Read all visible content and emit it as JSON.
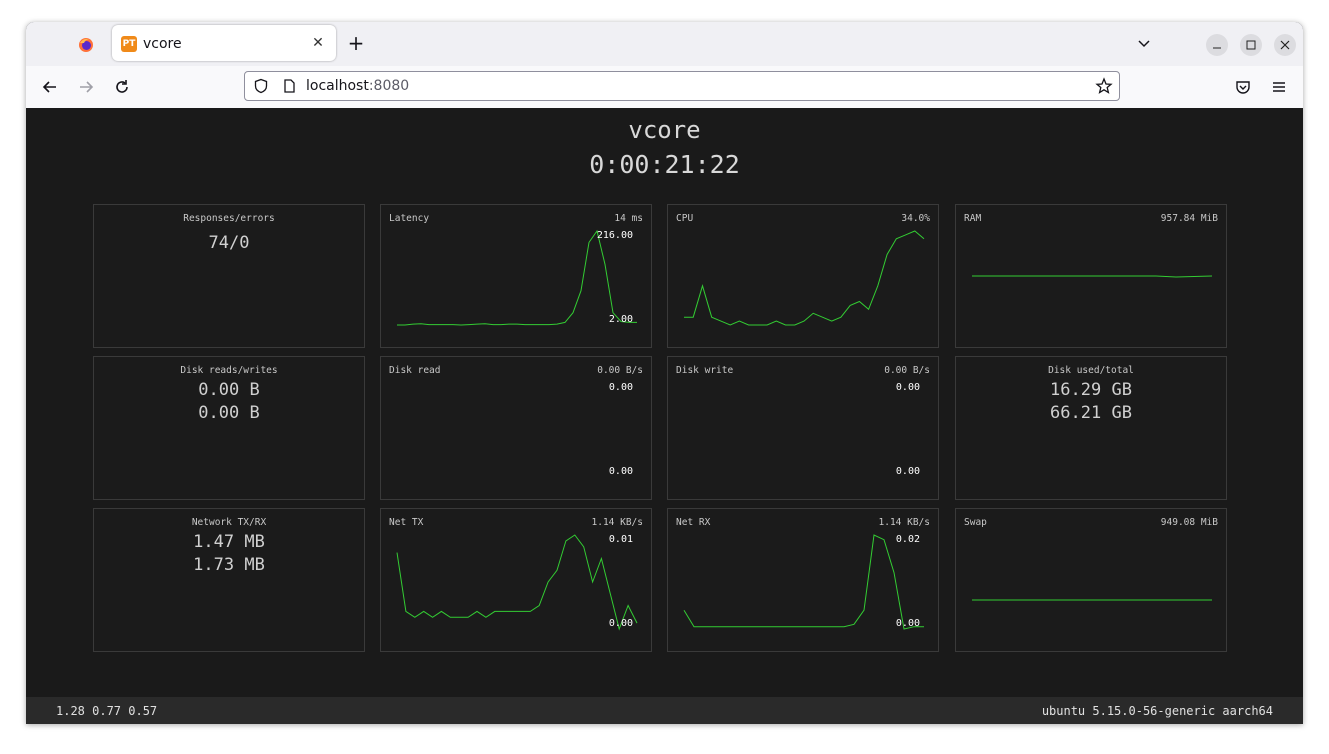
{
  "browser": {
    "tab_title": "vcore",
    "tab_favicon_text": "PT",
    "url_host": "localhost",
    "url_port": ":8080"
  },
  "app": {
    "title": "vcore",
    "uptime": "0:00:21:22"
  },
  "panels": {
    "responses": {
      "label": "Responses/errors",
      "value": "74/0"
    },
    "latency": {
      "label": "Latency",
      "current": "14 ms",
      "max": "216.00",
      "min": "2.00",
      "series": [
        2,
        2,
        4,
        5,
        3,
        3,
        3,
        3,
        2,
        3,
        4,
        5,
        3,
        3,
        4,
        4,
        3,
        3,
        3,
        3,
        4,
        8,
        30,
        80,
        190,
        216,
        140,
        30,
        10,
        8,
        8
      ]
    },
    "cpu": {
      "label": "CPU",
      "current": "34.0%",
      "series": [
        6,
        6,
        14,
        6,
        5,
        4,
        5,
        4,
        4,
        4,
        5,
        4,
        4,
        5,
        7,
        6,
        5,
        6,
        9,
        10,
        8,
        14,
        22,
        26,
        27,
        28,
        26
      ]
    },
    "ram": {
      "label": "RAM",
      "current": "957.84 MiB"
    },
    "disk_rw": {
      "label": "Disk reads/writes",
      "read": "0.00 B",
      "write": "0.00 B"
    },
    "disk_read": {
      "label": "Disk read",
      "current": "0.00 B/s",
      "max": "0.00",
      "min": "0.00"
    },
    "disk_write": {
      "label": "Disk write",
      "current": "0.00 B/s",
      "max": "0.00",
      "min": "0.00"
    },
    "disk_used": {
      "label": "Disk used/total",
      "used": "16.29 GB",
      "total": "66.21 GB"
    },
    "network": {
      "label": "Network TX/RX",
      "tx": "1.47 MB",
      "rx": "1.73 MB"
    },
    "net_tx": {
      "label": "Net TX",
      "current": "1.14 KB/s",
      "max": "0.01",
      "min": "0.00",
      "series": [
        0.007,
        0.002,
        0.0015,
        0.002,
        0.0015,
        0.002,
        0.0015,
        0.0015,
        0.0015,
        0.002,
        0.0015,
        0.002,
        0.002,
        0.002,
        0.002,
        0.002,
        0.0025,
        0.0045,
        0.0055,
        0.008,
        0.0085,
        0.0075,
        0.0045,
        0.0065,
        0.0035,
        0.0005,
        0.0025,
        0.001
      ]
    },
    "net_rx": {
      "label": "Net RX",
      "current": "1.14 KB/s",
      "max": "0.02",
      "min": "0.00",
      "series": [
        0.004,
        0.0005,
        0.0005,
        0.0005,
        0.0005,
        0.0005,
        0.0005,
        0.0005,
        0.0005,
        0.0005,
        0.0005,
        0.0005,
        0.0005,
        0.0005,
        0.0005,
        0.0005,
        0.0005,
        0.001,
        0.004,
        0.02,
        0.019,
        0.012,
        0.0,
        0.0005,
        0.0005
      ]
    },
    "swap": {
      "label": "Swap",
      "current": "949.08 MiB"
    }
  },
  "status": {
    "load": "1.28 0.77 0.57",
    "system": "ubuntu 5.15.0-56-generic aarch64"
  },
  "colors": {
    "line": "#33cc33",
    "background": "#1a1a1a"
  }
}
